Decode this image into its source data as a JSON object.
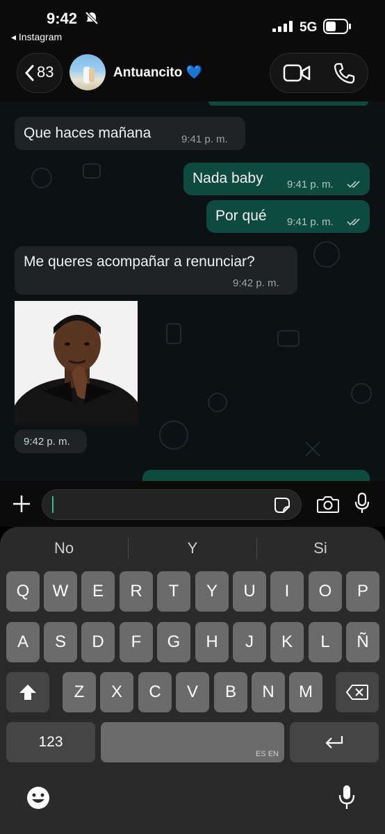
{
  "status_bar": {
    "time": "9:42",
    "back_app": "◂ Instagram",
    "network": "5G"
  },
  "header": {
    "back_count": "83",
    "contact_name": "Antuancito 💙"
  },
  "messages": [
    {
      "text": "Que haces mañana",
      "time": "9:41 p. m."
    },
    {
      "text": "Nada baby",
      "time": "9:41 p. m."
    },
    {
      "text": "Por qué",
      "time": "9:41 p. m."
    },
    {
      "text": "Me queres acompañar a renunciar?",
      "time": "9:42 p. m."
    },
    {
      "text": "",
      "time": "9:42 p. m."
    }
  ],
  "keyboard": {
    "suggestions": [
      "No",
      "Y",
      "Si"
    ],
    "row1": [
      "Q",
      "W",
      "E",
      "R",
      "T",
      "Y",
      "U",
      "I",
      "O",
      "P"
    ],
    "row2": [
      "A",
      "S",
      "D",
      "F",
      "G",
      "H",
      "J",
      "K",
      "L",
      "Ñ"
    ],
    "row3": [
      "Z",
      "X",
      "C",
      "V",
      "B",
      "N",
      "M"
    ],
    "numbers_key": "123",
    "space_lang": "ES EN"
  },
  "colors": {
    "chat_bg": "#0c1114",
    "incoming": "#1f2326",
    "outgoing": "#0f4a40",
    "accent_ticks": "#a9c9c1"
  }
}
